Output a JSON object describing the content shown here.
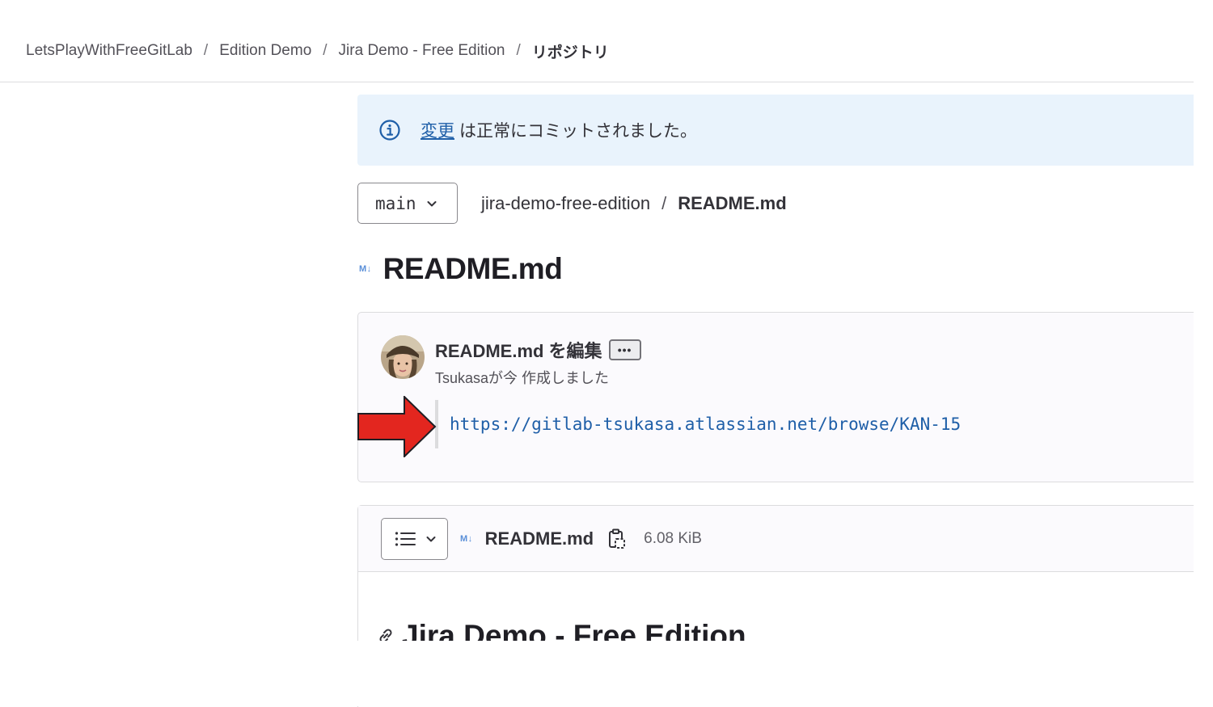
{
  "breadcrumb": {
    "items": [
      "LetsPlayWithFreeGitLab",
      "Edition Demo",
      "Jira Demo - Free Edition"
    ],
    "current": "リポジトリ",
    "separator": "/"
  },
  "alert": {
    "link_text": "変更",
    "message": "は正常にコミットされました。",
    "icon": "info-circle-icon"
  },
  "branch": {
    "label": "main"
  },
  "path": {
    "repo": "jira-demo-free-edition",
    "separator": "/",
    "file": "README.md"
  },
  "page": {
    "md_icon": "M↓",
    "title": "README.md"
  },
  "commit": {
    "title": "README.md を編集",
    "ellipsis": "•••",
    "author_line": "Tsukasaが今 作成しました",
    "description_url": "https://gitlab-tsukasa.atlassian.net/browse/KAN-15"
  },
  "annotation": {
    "arrow_color": "#e3261f"
  },
  "file": {
    "md_icon": "M↓",
    "name": "README.md",
    "size": "6.08 KiB",
    "readme_heading": "Jira Demo - Free Edition"
  }
}
